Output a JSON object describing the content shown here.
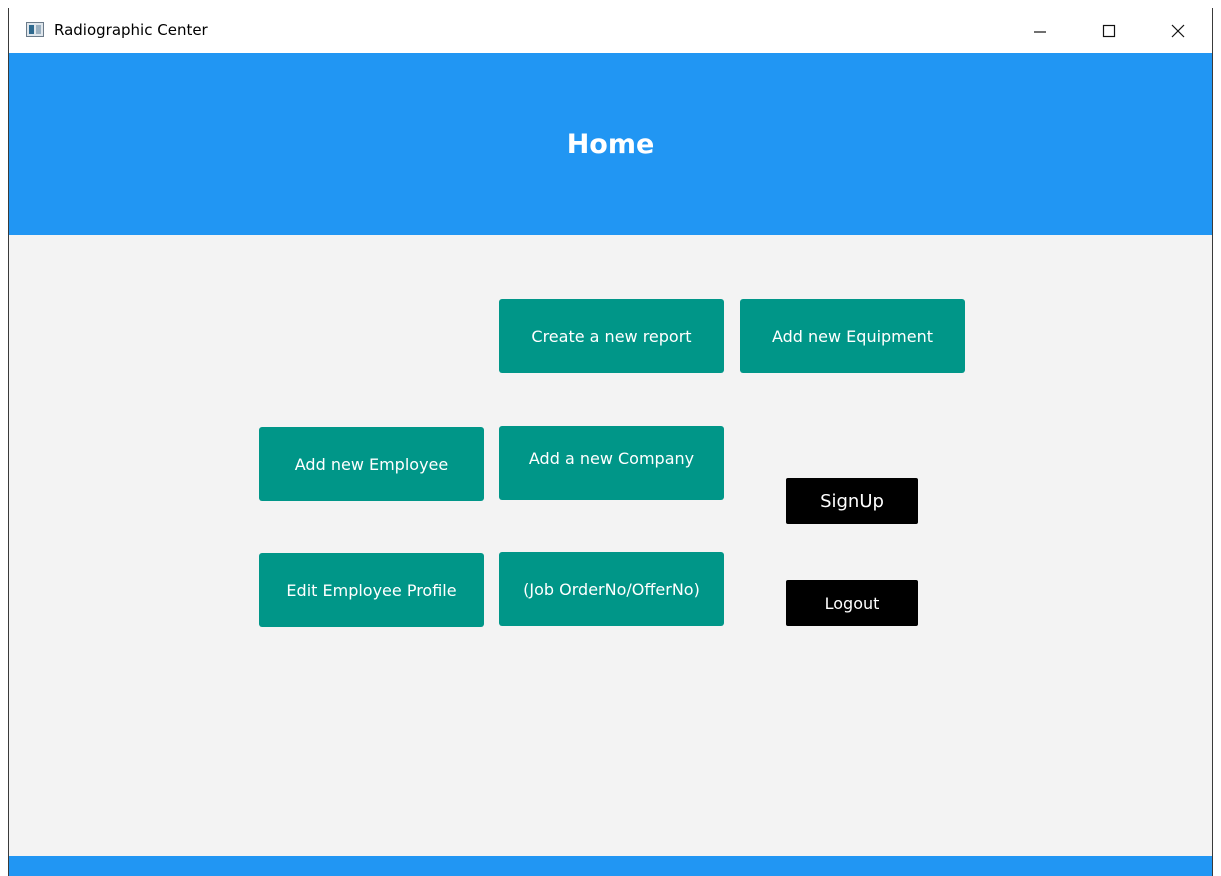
{
  "window": {
    "title": "Radiographic Center",
    "controls": {
      "minimize": "minimize-icon",
      "maximize": "maximize-icon",
      "close": "close-icon"
    }
  },
  "header": {
    "title": "Home",
    "color": "#2196f3"
  },
  "buttons": {
    "create_report": "Create a new report",
    "add_equipment": "Add new Equipment",
    "add_employee": "Add new Employee",
    "add_company": "Add a new Company",
    "edit_employee": "Edit Employee Profile",
    "job_order": "(Job OrderNo/OfferNo)",
    "signup": "SignUp",
    "logout": "Logout"
  },
  "colors": {
    "accent": "#009688",
    "dark_button": "#000000",
    "background": "#f3f3f3"
  }
}
